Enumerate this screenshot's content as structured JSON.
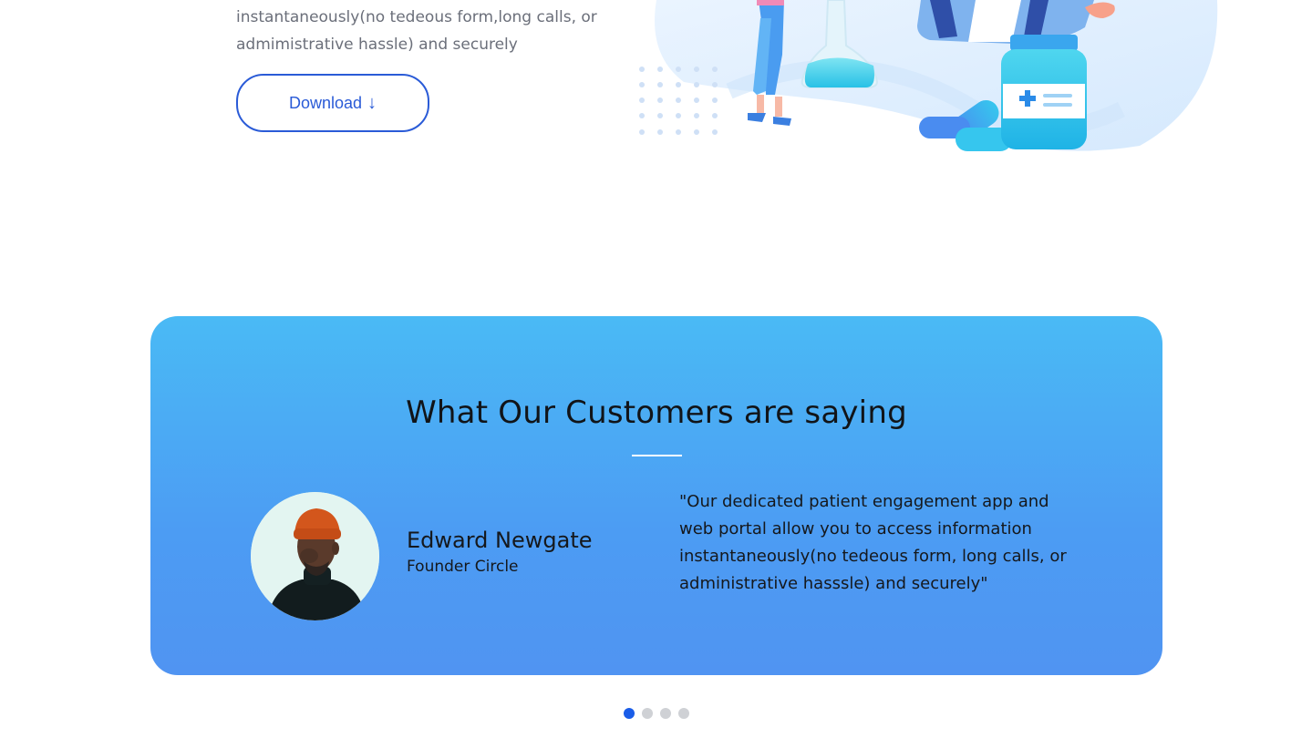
{
  "hero": {
    "description_lines": [
      "instantaneously(no tedeous form,long calls, or",
      "admimistrative hassle) and securely"
    ],
    "download_label": "Download",
    "download_icon": "down-arrow-icon",
    "download_icon_glyph": "↓",
    "illustration": "doctor-with-medicine-illustration"
  },
  "testimonials": {
    "title": "What Our Customers are saying",
    "active": {
      "avatar": "customer-avatar-photo",
      "name": "Edward Newgate",
      "role": "Founder Circle",
      "quote_lines": [
        "\"Our dedicated patient engagement app and",
        "web portal allow you to access information",
        "instantaneously(no tedeous form, long calls, or",
        "administrative hasssle) and securely\""
      ]
    },
    "carousel": {
      "slide_count": 4,
      "active_index": 0
    }
  },
  "colors": {
    "accent": "#2a5bd7",
    "card_gradient_top": "#4abaf5",
    "card_gradient_bottom": "#5094f2",
    "dot_active": "#1a5de8",
    "dot_inactive": "#cfd1d5"
  }
}
